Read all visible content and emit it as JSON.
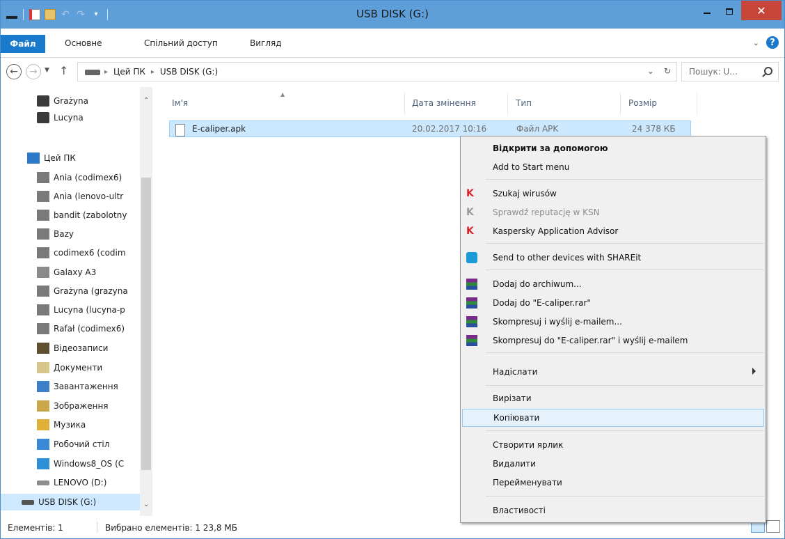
{
  "window": {
    "title": "USB DISK (G:)",
    "colors": {
      "titlebar": "#5e9fd9",
      "file_tab": "#1979ca",
      "close": "#c7463a",
      "selection": "#cce8ff"
    }
  },
  "ribbon": {
    "tabs": [
      "Файл",
      "Основне",
      "Спільний доступ",
      "Вигляд"
    ]
  },
  "address": {
    "crumbs": [
      "Цей ПК",
      "USB DISK (G:)"
    ],
    "search_placeholder": "Пошук: U..."
  },
  "navpane": {
    "items": [
      {
        "label": "Grażyna",
        "icon": "user-icon"
      },
      {
        "label": "Lucyna",
        "icon": "user-icon"
      },
      {
        "label": "Цей ПК",
        "icon": "computer-icon"
      },
      {
        "label": "Ania (codimex6)",
        "icon": "network-drive-icon"
      },
      {
        "label": "Ania (lenovo-ultr",
        "icon": "network-drive-icon"
      },
      {
        "label": "bandit (zabolotny",
        "icon": "network-drive-icon"
      },
      {
        "label": "Bazy",
        "icon": "network-drive-icon"
      },
      {
        "label": "codimex6 (codim",
        "icon": "network-drive-icon"
      },
      {
        "label": "Galaxy A3",
        "icon": "phone-icon"
      },
      {
        "label": "Grażyna (grazyna",
        "icon": "network-drive-icon"
      },
      {
        "label": "Lucyna (lucyna-p",
        "icon": "network-drive-icon"
      },
      {
        "label": "Rafał (codimex6)",
        "icon": "network-drive-icon"
      },
      {
        "label": "Відеозаписи",
        "icon": "videos-folder-icon"
      },
      {
        "label": "Документи",
        "icon": "documents-folder-icon"
      },
      {
        "label": "Завантаження",
        "icon": "downloads-folder-icon"
      },
      {
        "label": "Зображення",
        "icon": "pictures-folder-icon"
      },
      {
        "label": "Музика",
        "icon": "music-folder-icon"
      },
      {
        "label": "Робочий стіл",
        "icon": "desktop-folder-icon"
      },
      {
        "label": "Windows8_OS (C",
        "icon": "windows-drive-icon"
      },
      {
        "label": "LENOVO (D:)",
        "icon": "drive-icon"
      },
      {
        "label": "USB DISK (G:)",
        "icon": "usb-drive-icon"
      }
    ]
  },
  "filelist": {
    "columns": [
      "Ім'я",
      "Дата змінення",
      "Тип",
      "Розмір"
    ],
    "rows": [
      {
        "name": "E-caliper.apk",
        "date": "20.02.2017 10:16",
        "type": "Файл APK",
        "size": "24 378 КБ"
      }
    ]
  },
  "context_menu": {
    "items": [
      "Відкрити за допомогою",
      "Add to Start menu",
      "Szukaj wirusów",
      "Sprawdź reputację w KSN",
      "Kaspersky Application Advisor",
      "Send to other devices with SHAREit",
      "Dodaj do archiwum...",
      "Dodaj do \"E-caliper.rar\"",
      "Skompresuj i wyślij e-mailem...",
      "Skompresuj do \"E-caliper.rar\" i wyślij e-mailem",
      "Надіслати",
      "Вирізати",
      "Копіювати",
      "Створити ярлик",
      "Видалити",
      "Перейменувати",
      "Властивості"
    ]
  },
  "status": {
    "count": "Елементів: 1",
    "selected": "Вибрано елементів: 1  23,8 МБ"
  }
}
